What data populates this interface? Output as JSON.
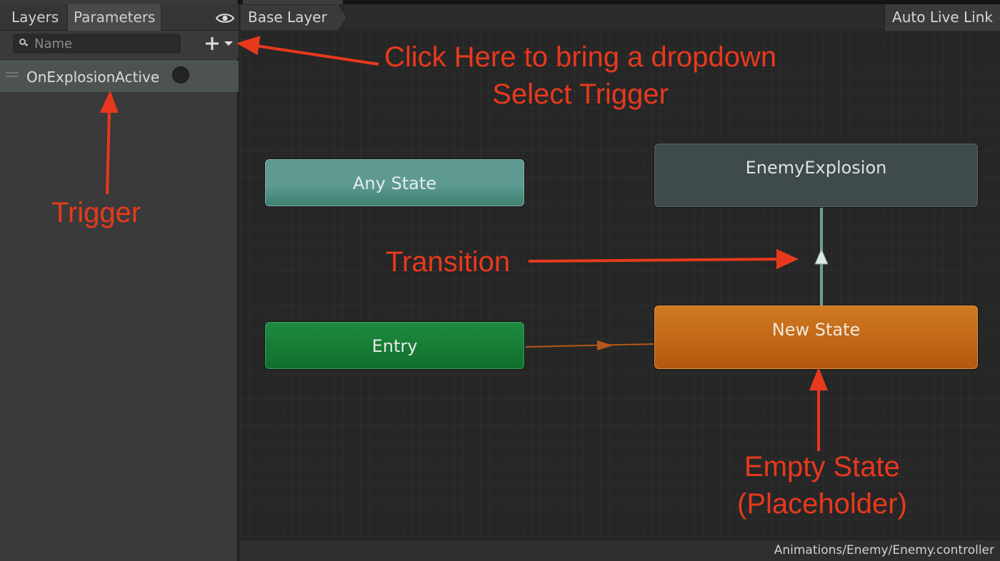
{
  "panel": {
    "tabs": [
      {
        "label": "Layers"
      },
      {
        "label": "Parameters"
      }
    ],
    "search": {
      "placeholder": "Name",
      "value": ""
    },
    "parameters": [
      {
        "name": "OnExplosionActive",
        "type": "trigger"
      }
    ]
  },
  "graph": {
    "breadcrumb": "Base Layer",
    "live_link_label": "Auto Live Link",
    "states": {
      "any_state": "Any State",
      "entry": "Entry",
      "enemy_explosion": "EnemyExplosion",
      "new_state": "New State"
    },
    "status_path": "Animations/Enemy/Enemy.controller"
  },
  "annotations": {
    "click_here": [
      "Click Here to bring a dropdown",
      "Select Trigger"
    ],
    "trigger": "Trigger",
    "transition": "Transition",
    "empty_state": [
      "Empty State",
      "(Placeholder)"
    ],
    "color": "#e8391d"
  },
  "colors": {
    "any_state": "#5e9a90",
    "entry": "#1f8a40",
    "enemy_explosion": "#3f4a4a",
    "new_state": "#d07a22",
    "canvas": "#262626",
    "panel": "#3a3a3a"
  }
}
